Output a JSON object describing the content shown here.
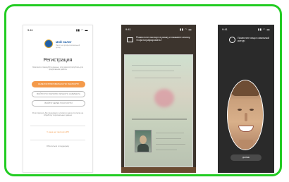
{
  "frame": {
    "accent": "#22cc22"
  },
  "phone1": {
    "status_time": "9:41",
    "status_icons": "▮▮ ◠ ▬",
    "app_name": "мой налог",
    "app_subtitle": "Налог на профессиональный доход",
    "title": "Регистрация",
    "description": "Заполните пожалуйста данные, или зарегистрируйтесь для продолжения работы",
    "buttons": [
      "ЗАРЕГИСТРИРОВАТЬСЯ ПО ПАСПОРТУ",
      "ВОЙТИ ПО ПАРОЛЮ ЛИЧНОГО КАБИНЕТА",
      "ВОЙТИ ЧЕРЕЗ ГОСУСЛУГИ"
    ],
    "note": "Регистрируясь Вы принимаете условия и даете согласие на обработку персональных данных",
    "link": "У меня нет паспорта РФ",
    "bottom": "Обратиться в поддержку",
    "accent": "#f49a4a"
  },
  "phone2": {
    "status_time": "9:41",
    "status_icons": "▮▮ ◠ ▬",
    "instruction": "Поместите паспорт в рамку и нажмите кнопку «Сфотографировать»",
    "icons": [
      "scan-icon"
    ]
  },
  "phone3": {
    "status_time": "9:41",
    "status_icons": "▮▮ ◠ ▬",
    "instruction": "Поместите лицо в овальный контур",
    "button": "ДАЛЕЕ",
    "icons": [
      "face-icon"
    ]
  }
}
